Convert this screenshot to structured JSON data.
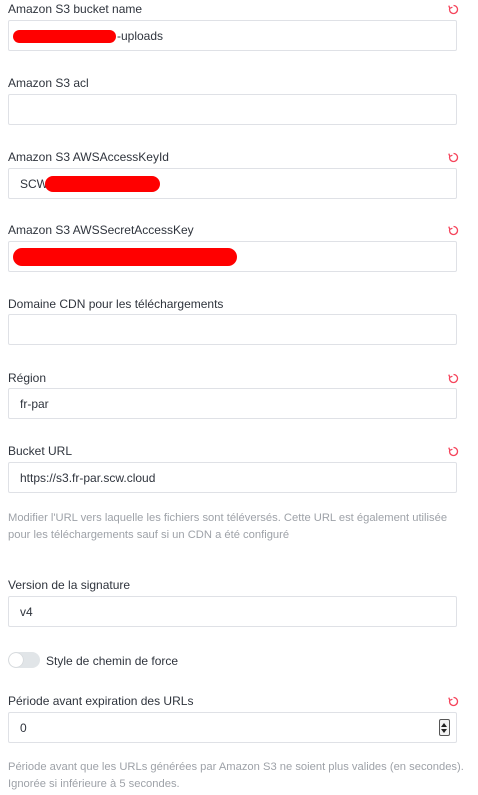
{
  "colors": {
    "reset_icon": "#f5455c",
    "redaction": "#ff0000",
    "label": "#2f343d",
    "hint": "#9ea2a8",
    "border": "#dfe1e6"
  },
  "fields": {
    "bucket_name": {
      "label": "Amazon S3 bucket name",
      "value_suffix": "-uploads"
    },
    "acl": {
      "label": "Amazon S3 acl",
      "value": ""
    },
    "access_key": {
      "label": "Amazon S3 AWSAccessKeyId",
      "value_prefix": "SCW"
    },
    "secret_key": {
      "label": "Amazon S3 AWSSecretAccessKey",
      "value": ""
    },
    "cdn_domain": {
      "label": "Domaine CDN pour les téléchargements",
      "value": ""
    },
    "region": {
      "label": "Région",
      "value": "fr-par"
    },
    "bucket_url": {
      "label": "Bucket URL",
      "value": "https://s3.fr-par.scw.cloud",
      "hint": "Modifier l'URL vers laquelle les fichiers sont téléversés. Cette URL est également utilisée pour les téléchargements sauf si un CDN a été configuré"
    },
    "signature_version": {
      "label": "Version de la signature",
      "value": "v4"
    },
    "force_path_style": {
      "label": "Style de chemin de force",
      "checked": false
    },
    "url_expiry": {
      "label": "Période avant expiration des URLs",
      "value": "0",
      "hint": "Période avant que les URLs générées par Amazon S3 ne soient plus valides (en secondes). Ignorée si inférieure à 5 secondes."
    }
  },
  "icons": {
    "reset": "reset-icon"
  }
}
